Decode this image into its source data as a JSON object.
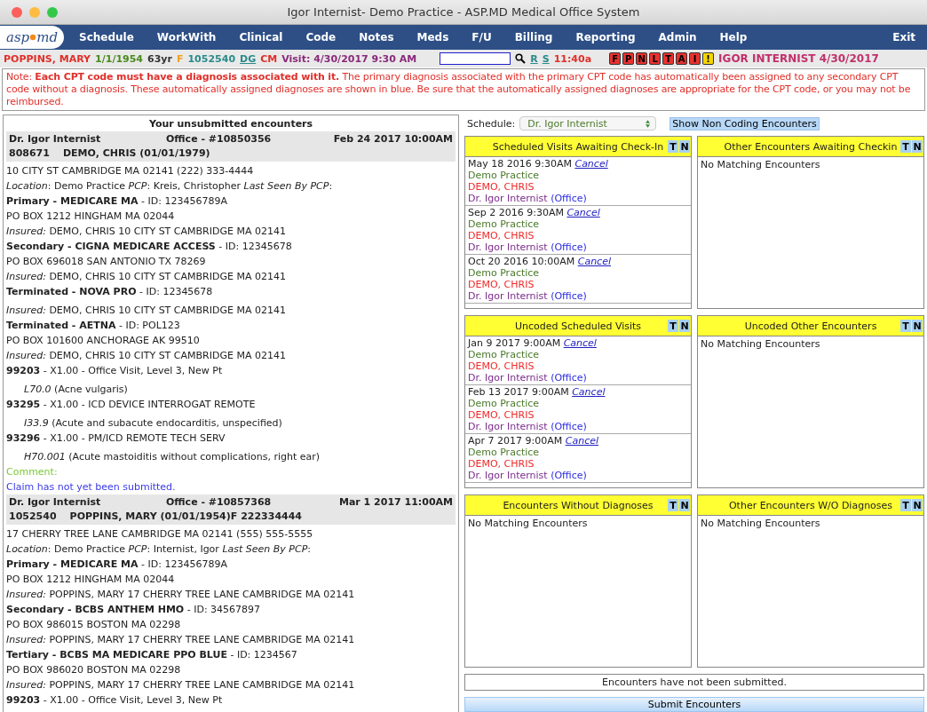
{
  "window": {
    "title": "Igor Internist- Demo Practice - ASP.MD Medical Office System"
  },
  "logo": {
    "left": "asp",
    "right": "md"
  },
  "menu": [
    "Schedule",
    "WorkWith",
    "Clinical",
    "Code",
    "Notes",
    "Meds",
    "F/U",
    "Billing",
    "Reporting",
    "Admin",
    "Help"
  ],
  "exit": "Exit",
  "patient_bar": {
    "name": "POPPINS, MARY",
    "dob": "1/1/1954",
    "age": "63yr",
    "sex": "F",
    "mrn": "1052540",
    "dg": "DG",
    "cm": "CM",
    "visit": "Visit: 4/30/2017 9:30 AM",
    "links": [
      "R",
      "S"
    ],
    "time": "11:40a",
    "flags": [
      {
        "label": "F",
        "color": "#e8312f"
      },
      {
        "label": "P",
        "color": "#e8312f"
      },
      {
        "label": "N",
        "color": "#e8312f"
      },
      {
        "label": "L",
        "color": "#e8312f"
      },
      {
        "label": "T",
        "color": "#e8312f"
      },
      {
        "label": "A",
        "color": "#e8312f"
      },
      {
        "label": "I",
        "color": "#e8312f"
      },
      {
        "label": "!",
        "color": "#f5d400"
      }
    ],
    "user": "IGOR INTERNIST 4/30/2017"
  },
  "note": "Note: **Each CPT code must have a diagnosis associated with it.** The primary diagnosis associated with the primary CPT code has automatically been assigned to any secondary CPT code without a diagnosis. These automatically assigned diagnoses are shown in blue. Be sure that the automatically assigned diagnoses are appropriate for the CPT code, or you may not be reimbursed.",
  "encounters_title": "Your unsubmitted encounters",
  "encounters": [
    {
      "provider": "Dr. Igor Internist",
      "office": "Office - #10850356",
      "datetime": "Feb 24 2017 10:00AM",
      "patient_id": "808671",
      "patient": "DEMO, CHRIS (01/01/1979)",
      "lines": [
        {
          "kind": "text",
          "text": "10 CITY ST CAMBRIDGE MA 02141 (222) 333-4444"
        },
        {
          "kind": "text",
          "text": "*Location*: Demo Practice *PCP*: Kreis, Christopher *Last Seen By PCP*:"
        },
        {
          "kind": "text",
          "text": "**Primary - MEDICARE MA** - ID: 123456789A"
        },
        {
          "kind": "text",
          "text": "PO BOX 1212 HINGHAM MA 02044"
        },
        {
          "kind": "text",
          "text": "*Insured:* DEMO, CHRIS 10 CITY ST CAMBRIDGE MA 02141"
        },
        {
          "kind": "text",
          "text": "**Secondary - CIGNA MEDICARE ACCESS** - ID: 12345678"
        },
        {
          "kind": "text",
          "text": "PO BOX 696018 SAN ANTONIO TX 78269"
        },
        {
          "kind": "text",
          "text": "*Insured:* DEMO, CHRIS 10 CITY ST CAMBRIDGE MA 02141"
        },
        {
          "kind": "gap",
          "text": "**Terminated - NOVA PRO** - ID: 12345678"
        },
        {
          "kind": "text",
          "text": "*Insured:* DEMO, CHRIS 10 CITY ST CAMBRIDGE MA 02141"
        },
        {
          "kind": "text",
          "text": "**Terminated - AETNA** - ID: POL123"
        },
        {
          "kind": "text",
          "text": "PO BOX 101600 ANCHORAGE AK 99510"
        },
        {
          "kind": "text",
          "text": "*Insured:* DEMO, CHRIS 10 CITY ST CAMBRIDGE MA 02141"
        },
        {
          "kind": "text",
          "text": "**99203** - X1.00 - Office Visit, Level 3, New Pt"
        },
        {
          "kind": "diagnosis",
          "text": "*L70.0* (Acne vulgaris)"
        },
        {
          "kind": "text",
          "text": "**93295** - X1.00 - ICD DEVICE INTERROGAT REMOTE"
        },
        {
          "kind": "diagnosis",
          "text": "*I33.9* (Acute and subacute endocarditis, unspecified)"
        },
        {
          "kind": "text",
          "text": "**93296** - X1.00 - PM/ICD REMOTE TECH SERV"
        },
        {
          "kind": "diagnosis",
          "text": "*H70.001* (Acute mastoiditis without complications, right ear)"
        },
        {
          "kind": "comment",
          "text": "Comment:"
        },
        {
          "kind": "status",
          "text": "Claim has not yet been submitted."
        }
      ]
    },
    {
      "provider": "Dr. Igor Internist",
      "office": "Office - #10857368",
      "datetime": "Mar 1 2017 11:00AM",
      "patient_id": "1052540",
      "patient": "POPPINS, MARY (01/01/1954)F 222334444",
      "lines": [
        {
          "kind": "text",
          "text": "17 CHERRY TREE LANE CAMBRIDGE MA 02141 (555) 555-5555"
        },
        {
          "kind": "text",
          "text": "*Location*: Demo Practice *PCP*: Internist, Igor *Last Seen By PCP*:"
        },
        {
          "kind": "text",
          "text": "**Primary - MEDICARE MA** - ID: 123456789A"
        },
        {
          "kind": "text",
          "text": "PO BOX 1212 HINGHAM MA 02044"
        },
        {
          "kind": "text",
          "text": "*Insured:* POPPINS, MARY 17 CHERRY TREE LANE CAMBRIDGE MA 02141"
        },
        {
          "kind": "text",
          "text": "**Secondary - BCBS ANTHEM HMO** - ID: 34567897"
        },
        {
          "kind": "text",
          "text": "PO BOX 986015 BOSTON MA 02298"
        },
        {
          "kind": "text",
          "text": "*Insured:* POPPINS, MARY 17 CHERRY TREE LANE CAMBRIDGE MA 02141"
        },
        {
          "kind": "text",
          "text": "**Tertiary - BCBS MA MEDICARE PPO BLUE** - ID: 1234567"
        },
        {
          "kind": "text",
          "text": "PO BOX 986020 BOSTON MA 02298"
        },
        {
          "kind": "text",
          "text": "*Insured:* POPPINS, MARY 17 CHERRY TREE LANE CAMBRIDGE MA 02141"
        },
        {
          "kind": "text",
          "text": "**99203** - X1.00 - Office Visit, Level 3, New Pt"
        }
      ]
    }
  ],
  "schedule": {
    "label": "Schedule:",
    "value": "Dr. Igor Internist"
  },
  "show_non_coding": "Show Non Coding Encounters",
  "panels": [
    {
      "title": "Scheduled Visits Awaiting Check-In",
      "buttons": [
        "T",
        "N"
      ],
      "items": [
        {
          "datetime": "May 18 2016 9:30AM",
          "cancel": "Cancel",
          "practice": "Demo Practice",
          "patient": "DEMO, CHRIS",
          "provider": "Dr. Igor Internist",
          "type": "(Office)"
        },
        {
          "datetime": "Sep 2 2016 9:30AM",
          "cancel": "Cancel",
          "practice": "Demo Practice",
          "patient": "DEMO, CHRIS",
          "provider": "Dr. Igor Internist",
          "type": "(Office)"
        },
        {
          "datetime": "Oct 20 2016 10:00AM",
          "cancel": "Cancel",
          "practice": "Demo Practice",
          "patient": "DEMO, CHRIS",
          "provider": "Dr. Igor Internist",
          "type": "(Office)"
        }
      ]
    },
    {
      "title": "Other Encounters Awaiting Checkin",
      "buttons": [
        "T",
        "N"
      ],
      "empty": "No Matching Encounters"
    },
    {
      "title": "Uncoded Scheduled Visits",
      "buttons": [
        "T",
        "N"
      ],
      "items": [
        {
          "datetime": "Jan 9 2017 9:00AM",
          "cancel": "Cancel",
          "practice": "Demo Practice",
          "patient": "DEMO, CHRIS",
          "provider": "Dr. Igor Internist",
          "type": "(Office)"
        },
        {
          "datetime": "Feb 13 2017 9:00AM",
          "cancel": "Cancel",
          "practice": "Demo Practice",
          "patient": "DEMO, CHRIS",
          "provider": "Dr. Igor Internist",
          "type": "(Office)"
        },
        {
          "datetime": "Apr 7 2017 9:00AM",
          "cancel": "Cancel",
          "practice": "Demo Practice",
          "patient": "DEMO, CHRIS",
          "provider": "Dr. Igor Internist",
          "type": "(Office)"
        }
      ]
    },
    {
      "title": "Uncoded Other Encounters",
      "buttons": [
        "T",
        "N"
      ],
      "empty": "No Matching Encounters"
    },
    {
      "title": "Encounters Without Diagnoses",
      "buttons": [
        "T",
        "N"
      ],
      "empty": "No Matching Encounters"
    },
    {
      "title": "Other Encounters W/O Diagnoses",
      "buttons": [
        "T",
        "N"
      ],
      "empty": "No Matching Encounters"
    }
  ],
  "submit_status": "Encounters have not been submitted.",
  "submit_button": "Submit Encounters"
}
